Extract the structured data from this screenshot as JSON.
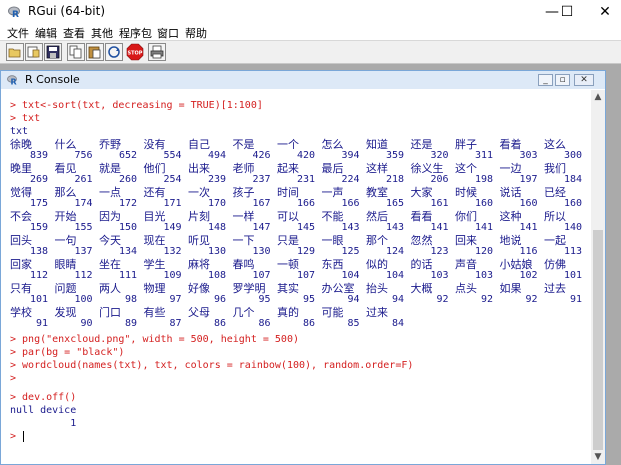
{
  "app": {
    "title": "RGui (64-bit)",
    "minimize_glyph": "—",
    "maximize_glyph": "☐",
    "close_glyph": "✕"
  },
  "menu": [
    "文件",
    "编辑",
    "查看",
    "其他",
    "程序包",
    "窗口",
    "帮助"
  ],
  "toolbar": {
    "buttons": [
      "open-script-icon",
      "load-workspace-icon",
      "save-workspace-icon",
      "copy-icon",
      "paste-icon",
      "copy-paste-icon",
      "stop-icon",
      "print-icon"
    ],
    "stop_label": "STOP"
  },
  "console": {
    "title": "R Console",
    "minimize_glyph": "_",
    "restore_glyph": "▫",
    "close_glyph": "✕",
    "lines": [
      {
        "text": "> txt<-sort(txt, decreasing = TRUE)[1:100]",
        "kind": "cmd"
      },
      {
        "text": "> txt",
        "kind": "cmd"
      },
      {
        "text": "txt",
        "kind": "out"
      }
    ],
    "table": [
      {
        "words": [
          "徐晚",
          "什么",
          "乔野",
          "没有",
          "自己",
          "不是",
          "一个",
          "怎么",
          "知道",
          "还是",
          "胖子",
          "看着",
          "这么"
        ],
        "counts": [
          "839",
          "756",
          "652",
          "554",
          "494",
          "426",
          "420",
          "394",
          "359",
          "320",
          "311",
          "303",
          "300"
        ]
      },
      {
        "words": [
          "晚里",
          "看见",
          "就是",
          "他们",
          "出来",
          "老师",
          "起来",
          "最后",
          "这样",
          "徐义生",
          "这个",
          "一边",
          "我们"
        ],
        "counts": [
          "269",
          "261",
          "260",
          "254",
          "239",
          "237",
          "231",
          "224",
          "218",
          "206",
          "198",
          "197",
          "184"
        ]
      },
      {
        "words": [
          "觉得",
          "那么",
          "一点",
          "还有",
          "一次",
          "孩子",
          "时间",
          "一声",
          "教室",
          "大家",
          "时候",
          "说话",
          "已经"
        ],
        "counts": [
          "175",
          "174",
          "172",
          "171",
          "170",
          "167",
          "166",
          "166",
          "165",
          "161",
          "160",
          "160",
          "160"
        ]
      },
      {
        "words": [
          "不会",
          "开始",
          "因为",
          "目光",
          "片刻",
          "一样",
          "可以",
          "不能",
          "然后",
          "看看",
          "你们",
          "这种",
          "所以"
        ],
        "counts": [
          "159",
          "155",
          "150",
          "149",
          "148",
          "147",
          "145",
          "143",
          "143",
          "141",
          "141",
          "141",
          "140"
        ]
      },
      {
        "words": [
          "回头",
          "一句",
          "今天",
          "现在",
          "听见",
          "一下",
          "只是",
          "一眼",
          "那个",
          "忽然",
          "回来",
          "地说",
          "一起"
        ],
        "counts": [
          "138",
          "137",
          "134",
          "132",
          "130",
          "130",
          "129",
          "125",
          "124",
          "123",
          "120",
          "116",
          "113"
        ]
      },
      {
        "words": [
          "回家",
          "眼睛",
          "坐在",
          "学生",
          "麻将",
          "春鸣",
          "一顿",
          "东西",
          "似的",
          "的话",
          "声音",
          "小姑娘",
          "仿佛"
        ],
        "counts": [
          "112",
          "112",
          "111",
          "109",
          "108",
          "107",
          "107",
          "104",
          "104",
          "103",
          "103",
          "102",
          "101"
        ]
      },
      {
        "words": [
          "只有",
          "问题",
          "两人",
          "物理",
          "好像",
          "罗学明",
          "其实",
          "办公室",
          "抬头",
          "大概",
          "点头",
          "如果",
          "过去"
        ],
        "counts": [
          "101",
          "100",
          "98",
          "97",
          "96",
          "95",
          "95",
          "94",
          "94",
          "92",
          "92",
          "92",
          "91"
        ]
      },
      {
        "words": [
          "学校",
          "发现",
          "门口",
          "有些",
          "父母",
          "几个",
          "真的",
          "可能",
          "过来",
          "",
          "",
          "",
          ""
        ],
        "counts": [
          "91",
          "90",
          "89",
          "87",
          "86",
          "86",
          "86",
          "85",
          "84",
          "",
          "",
          "",
          ""
        ]
      }
    ],
    "after_lines": [
      {
        "text": "> png(\"enxcloud.png\", width = 500, height = 500)",
        "kind": "cmd"
      },
      {
        "text": "> par(bg = \"black\")",
        "kind": "cmd"
      },
      {
        "text": "> wordcloud(names(txt), txt, colors = rainbow(100), random.order=F)",
        "kind": "cmd"
      },
      {
        "text": ">",
        "kind": "cmd"
      },
      {
        "text": "> dev.off()",
        "kind": "cmd"
      },
      {
        "text": "null device",
        "kind": "out"
      },
      {
        "text": "          1",
        "kind": "out"
      },
      {
        "text": "> ",
        "kind": "cmd"
      }
    ]
  }
}
